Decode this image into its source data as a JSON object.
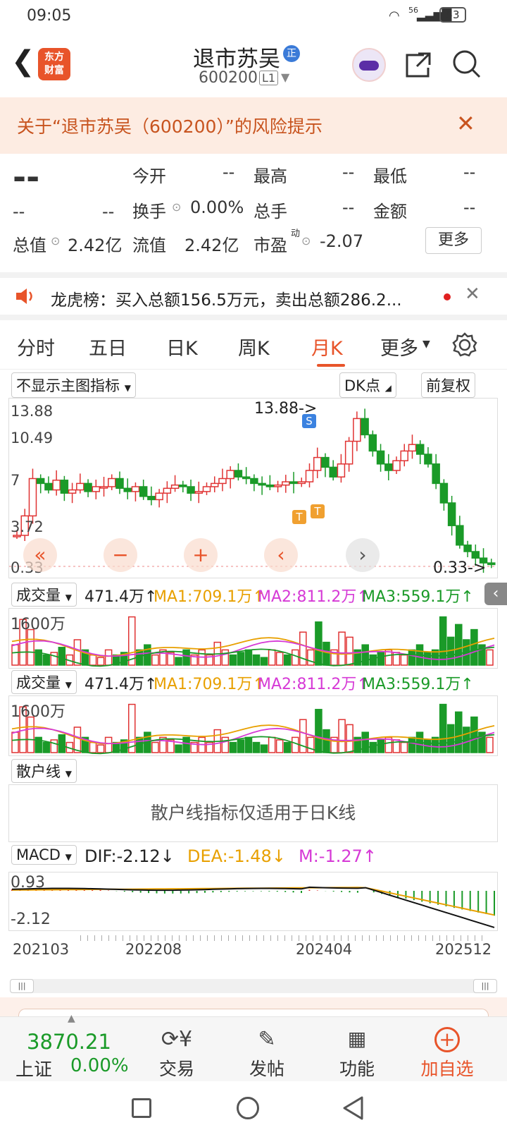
{
  "status": {
    "time": "09:05",
    "signal": "56",
    "battery": "53"
  },
  "header": {
    "logo_line1": "东方",
    "logo_line2": "财富",
    "title": "退市苏吴",
    "badge": "正",
    "code": "600200",
    "level": "L1"
  },
  "alert": {
    "text": "关于“退市苏吴（600200）”的风险提示"
  },
  "quote": {
    "price": "--",
    "change": "--",
    "change_pct": "--",
    "open_label": "今开",
    "open": "--",
    "high_label": "最高",
    "high": "--",
    "low_label": "最低",
    "low": "--",
    "turnover_label": "换手",
    "turnover": "0.00%",
    "volume_label": "总手",
    "volume": "--",
    "amount_label": "金额",
    "amount": "--",
    "mcap_label": "总值",
    "mcap": "2.42亿",
    "float_label": "流值",
    "float": "2.42亿",
    "pe_label": "市盈",
    "pe_sup": "动",
    "pe": "-2.07",
    "more": "更多"
  },
  "announcement": {
    "text": "龙虎榜：买入总额156.5万元，卖出总额286.2..."
  },
  "tabs": {
    "t1": "分时",
    "t2": "五日",
    "t3": "日K",
    "t4": "周K",
    "t5": "月K",
    "t6": "更多",
    "active": "月K"
  },
  "main_chart": {
    "indicator_select": "不显示主图指标",
    "dk": "DK点",
    "adjust": "前复权",
    "y_top": "13.88",
    "y_2": "10.49",
    "y_3": "7",
    "y_4": "3.72",
    "y_bottom": "0.33",
    "max_label": "13.88->",
    "min_label": "0.33->",
    "marker_s": "S",
    "marker_t": "T"
  },
  "volume1": {
    "select": "成交量",
    "vol": "471.4万↑",
    "ma1": "MA1:709.1万↑",
    "ma2": "MA2:811.2万↑",
    "ma3": "MA3:559.1万↑",
    "axis": "1600万"
  },
  "volume2": {
    "select": "成交量",
    "vol": "471.4万↑",
    "ma1": "MA1:709.1万↑",
    "ma2": "MA2:811.2万↑",
    "ma3": "MA3:559.1万↑",
    "axis": "1600万"
  },
  "retail": {
    "select": "散户线",
    "note": "散户线指标仅适用于日K线"
  },
  "macd": {
    "select": "MACD",
    "dif": "DIF:-2.12↓",
    "dea": "DEA:-1.48↓",
    "m": "M:-1.27↑",
    "y_top": "0.93",
    "y_bottom": "-2.12"
  },
  "dates": {
    "d1": "202103",
    "d2": "202208",
    "d3": "202404",
    "d4": "202512"
  },
  "bottom_nav": {
    "index_value": "3870.21",
    "index_name": "上证",
    "index_change": "0.00%",
    "trade": "交易",
    "post": "发帖",
    "func": "功能",
    "add": "加自选"
  },
  "colors": {
    "up": "#e03333",
    "down": "#1a9a28",
    "accent": "#e8542a",
    "ma1": "#e8a000",
    "ma2": "#d63ad6",
    "ma3": "#1a9a28"
  }
}
